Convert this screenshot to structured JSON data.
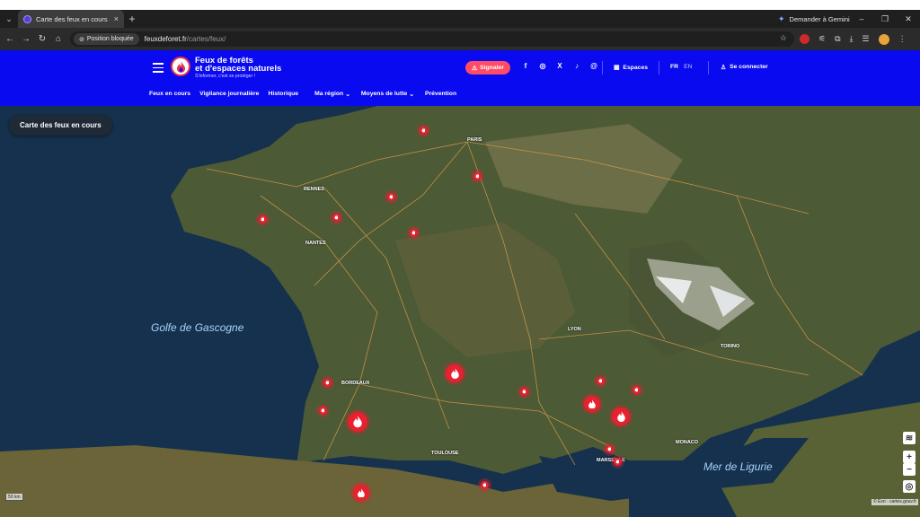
{
  "browser": {
    "tab_title": "Carte des feux en cours — Feu",
    "tab_close": "×",
    "new_tab": "+",
    "gemini_label": "Demander à Gemini",
    "permission_chip": "Position bloquée",
    "url_host": "feuxdeforet.fr",
    "url_path": "/cartes/feux/"
  },
  "site": {
    "brand_line1": "Feux de forêts",
    "brand_line2": "et d'espaces naturels",
    "brand_tagline": "S'informer, c'est se protéger !",
    "report_button": "Signaler",
    "spaces_label": "Espaces",
    "lang_fr": "FR",
    "lang_en": "EN",
    "login_label": "Se connecter",
    "nav": [
      {
        "label": "Feux en cours"
      },
      {
        "label": "Vigilance journalière"
      },
      {
        "label": "Historique"
      },
      {
        "label": "Ma région"
      },
      {
        "label": "Moyens de lutte"
      },
      {
        "label": "Prévention"
      }
    ],
    "social_icons": [
      "facebook-icon",
      "instagram-icon",
      "x-icon",
      "tiktok-icon",
      "threads-icon"
    ]
  },
  "map": {
    "title": "Carte des feux en cours",
    "sea_labels": [
      "Golfe de Gascogne",
      "Mer de Ligurie"
    ],
    "city_labels": [
      "PARIS",
      "RENNES",
      "NANTES",
      "BORDEAUX",
      "LYON",
      "TOULOUSE",
      "MARSEILLE",
      "MONACO",
      "TORINO"
    ],
    "zoom_in": "+",
    "zoom_out": "−",
    "scale_label": "50 km",
    "attribution": "© Esri - cartes.gouv.fr",
    "colors": {
      "fire": "#e8202f",
      "header": "#0a0af0",
      "report": "#ff4b63"
    }
  }
}
